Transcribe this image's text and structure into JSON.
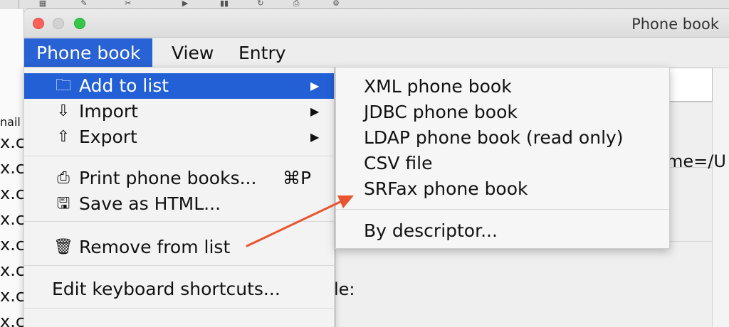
{
  "background": {
    "left_column_header": "nail",
    "left_column_rows": [
      "x.c",
      "x.c",
      "x.c",
      "x.c",
      "x.c",
      "x.c",
      "x.c",
      "x.c"
    ],
    "path_fragment": "me=/U",
    "field_fragment": "le:"
  },
  "window": {
    "title": "Phone book"
  },
  "menubar": {
    "items": [
      {
        "label": "Phone book"
      },
      {
        "label": "View"
      },
      {
        "label": "Entry"
      }
    ]
  },
  "menu": {
    "items": [
      {
        "label": "Add to list",
        "icon": "folder-icon"
      },
      {
        "label": "Import",
        "icon": "import-icon"
      },
      {
        "label": "Export",
        "icon": "export-icon"
      },
      {
        "label": "Print phone books...",
        "icon": "printer-icon",
        "shortcut": "⌘P"
      },
      {
        "label": "Save as HTML...",
        "icon": "floppy-disk-icon"
      },
      {
        "label": "Remove from list",
        "icon": "trash-icon"
      },
      {
        "label": "Edit keyboard shortcuts..."
      }
    ],
    "arrow": "▶"
  },
  "submenu": {
    "items": [
      {
        "label": "XML phone book"
      },
      {
        "label": "JDBC phone book"
      },
      {
        "label": "LDAP phone book (read only)"
      },
      {
        "label": "CSV file"
      },
      {
        "label": "SRFax phone book"
      },
      {
        "label": "By descriptor..."
      }
    ]
  },
  "colors": {
    "highlight": "#2360d6",
    "annotation_arrow": "#e8542f"
  }
}
